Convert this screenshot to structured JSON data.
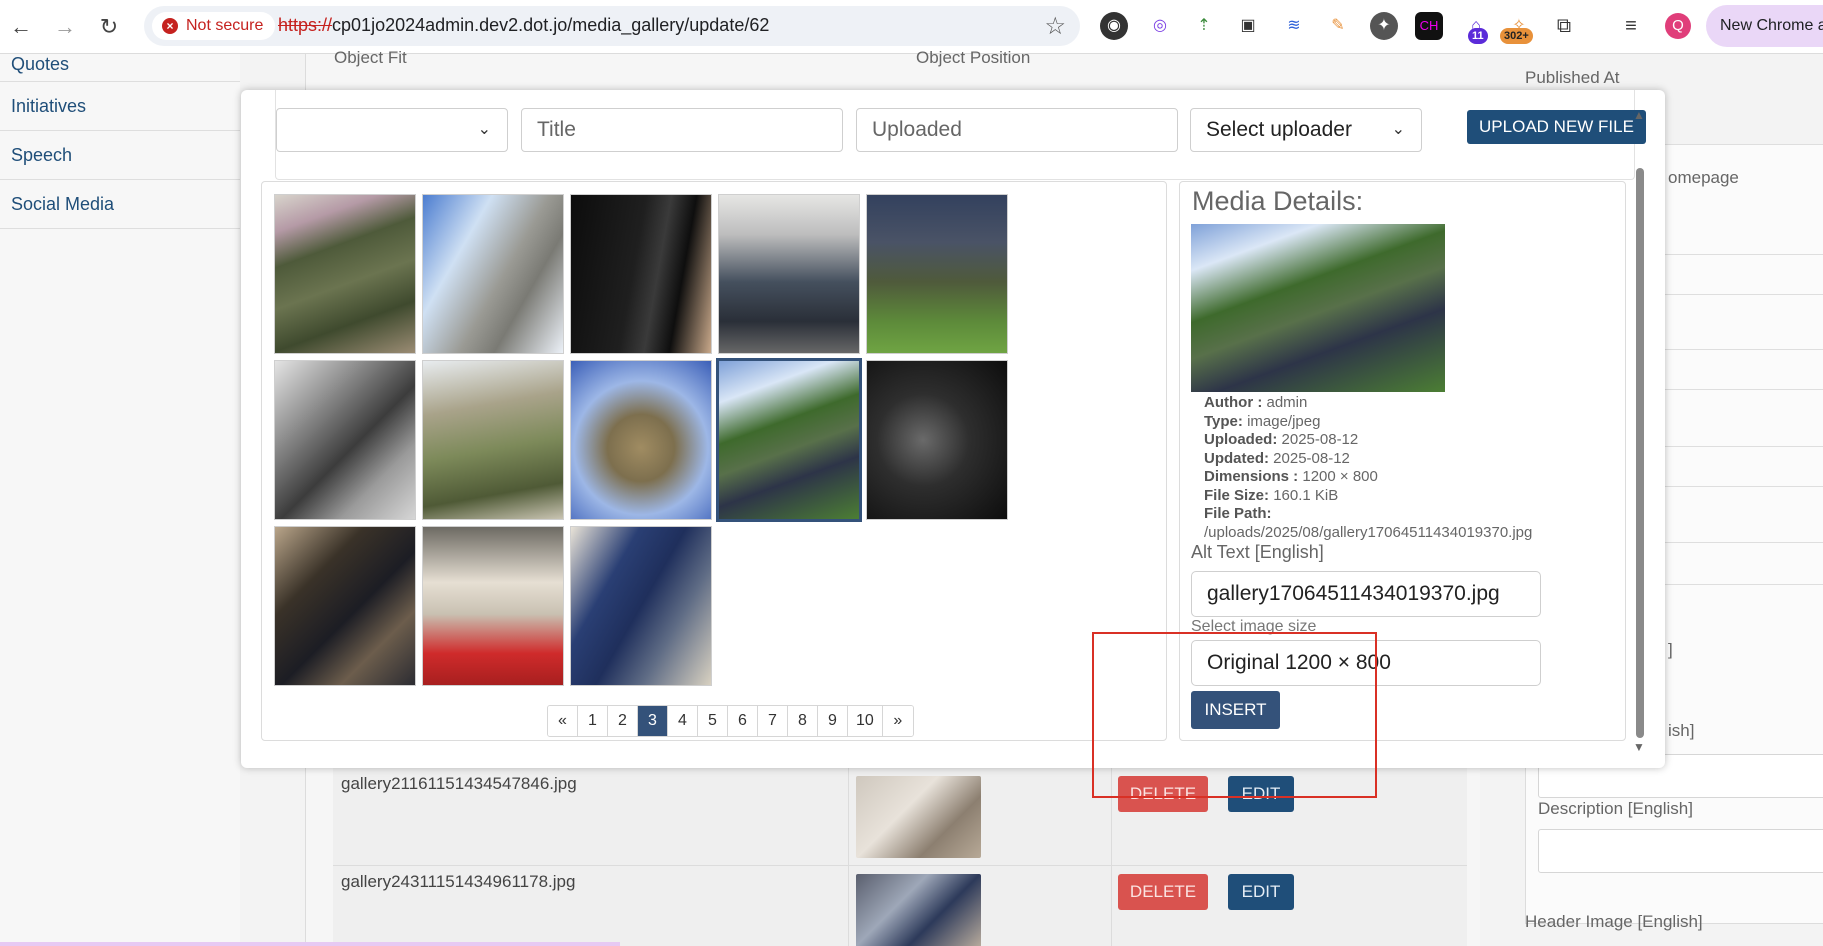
{
  "browser": {
    "security_label": "Not secure",
    "url_scheme": "https://",
    "url_rest": "cp01jo2024admin.dev2.dot.jo/media_gallery/update/62",
    "new_chrome_label": "New Chrome av",
    "profile_initial": "Q",
    "ext_badge_1": "11",
    "ext_badge_2": "302+"
  },
  "sidebar": {
    "items": [
      {
        "label": "Quotes"
      },
      {
        "label": "Initiatives"
      },
      {
        "label": "Speech"
      },
      {
        "label": "Social Media"
      }
    ]
  },
  "background": {
    "object_fit_label": "Object Fit",
    "object_position_label": "Object Position",
    "published_at_label": "Published At",
    "homepage_fragment": "omepage",
    "bracket_fragment": "]",
    "english_fragment": "ish]",
    "description_label": "Description [English]",
    "header_image_label": "Header Image [English]",
    "rows": [
      {
        "filename": "gallery21161151434547846.jpg",
        "delete": "DELETE",
        "edit": "EDIT"
      },
      {
        "filename": "gallery24311151434961178.jpg",
        "delete": "DELETE",
        "edit": "EDIT"
      }
    ]
  },
  "modal": {
    "filters": {
      "first_select": "",
      "title_placeholder": "Title",
      "uploaded_placeholder": "Uploaded",
      "uploader_select": "Select uploader"
    },
    "upload_button": "UPLOAD NEW FILE",
    "pagination": [
      "«",
      "1",
      "2",
      "3",
      "4",
      "5",
      "6",
      "7",
      "8",
      "9",
      "10",
      "»"
    ],
    "active_page": "3",
    "details": {
      "title": "Media Details:",
      "author_label": "Author :",
      "author": "admin",
      "type_label": "Type:",
      "type": "image/jpeg",
      "uploaded_label": "Uploaded:",
      "uploaded": "2025-08-12",
      "updated_label": "Updated:",
      "updated": "2025-08-12",
      "dimensions_label": "Dimensions :",
      "dimensions": "1200 × 800",
      "file_size_label": "File Size:",
      "file_size": "160.1 KiB",
      "file_path_label": "File Path:",
      "file_path": "/uploads/2025/08/gallery17064511434019370.jpg",
      "alt_label": "Alt Text [English]",
      "alt_value": "gallery17064511434019370.jpg",
      "size_label": "Select image size",
      "size_value": "Original 1200 × 800",
      "insert_button": "INSERT"
    }
  },
  "colors": {
    "primary": "#34527a",
    "danger": "#d9534f",
    "link": "#1f4e79",
    "highlight_box": "#d93025"
  }
}
